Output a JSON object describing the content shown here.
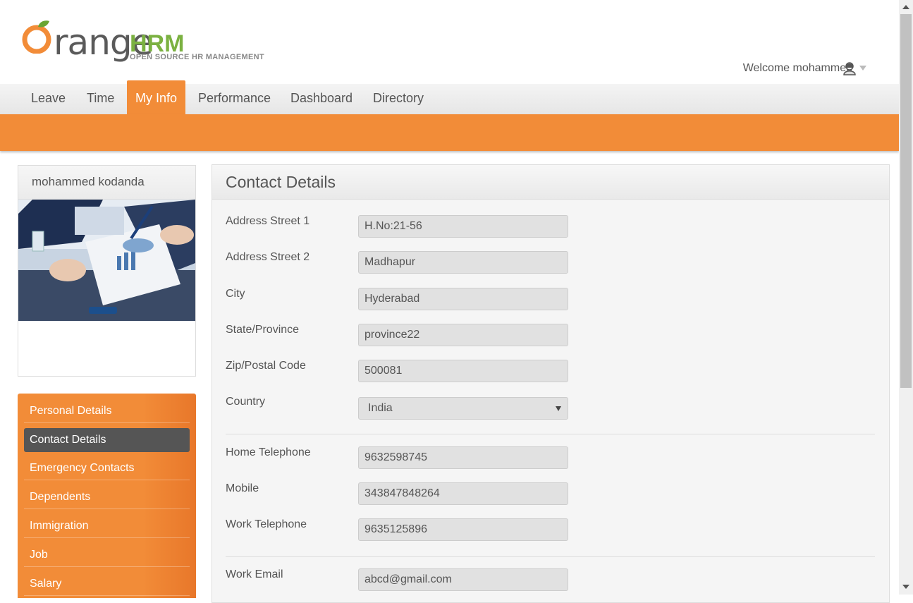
{
  "header": {
    "logo_word": "range",
    "logo_hrm": "HRM",
    "logo_sub": "OPEN SOURCE HR MANAGEMENT",
    "welcome": "Welcome mohammed"
  },
  "nav": {
    "items": [
      "Leave",
      "Time",
      "My Info",
      "Performance",
      "Dashboard",
      "Directory"
    ],
    "active": "My Info"
  },
  "profile": {
    "name": "mohammed kodanda"
  },
  "sidemenu": {
    "items": [
      "Personal Details",
      "Contact Details",
      "Emergency Contacts",
      "Dependents",
      "Immigration",
      "Job",
      "Salary"
    ],
    "active": "Contact Details"
  },
  "contact": {
    "title": "Contact Details",
    "address1_label": "Address Street 1",
    "address1": "H.No:21-56",
    "address2_label": "Address Street 2",
    "address2": "Madhapur",
    "city_label": "City",
    "city": "Hyderabad",
    "state_label": "State/Province",
    "state": "province22",
    "zip_label": "Zip/Postal Code",
    "zip": "500081",
    "country_label": "Country",
    "country": "India",
    "home_tel_label": "Home Telephone",
    "home_tel": "9632598745",
    "mobile_label": "Mobile",
    "mobile": "343847848264",
    "work_tel_label": "Work Telephone",
    "work_tel": "9635125896",
    "work_email_label": "Work Email",
    "work_email": "abcd@gmail.com"
  },
  "colors": {
    "brand_orange": "#f28c38",
    "brand_green": "#7bb141",
    "active_side": "#555555"
  }
}
